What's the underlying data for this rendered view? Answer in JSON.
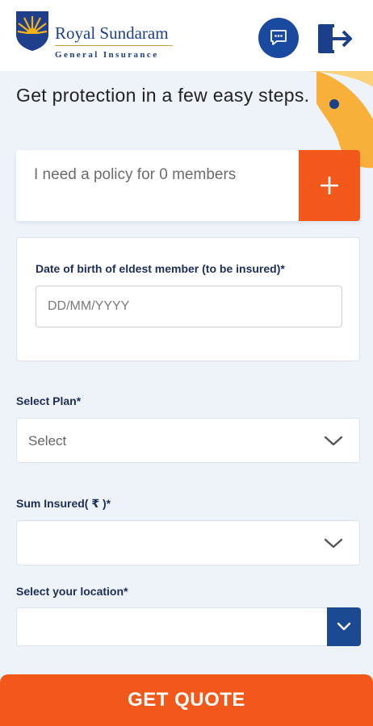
{
  "header": {
    "logo": {
      "name": "Royal Sundaram",
      "tagline": "General Insurance"
    },
    "chat_icon": "chat-bubble-icon",
    "logout_icon": "logout-icon"
  },
  "intro": {
    "heading": "Get protection in a few easy steps."
  },
  "members": {
    "text": "I need a policy for 0 members",
    "add_icon": "plus-icon"
  },
  "dob": {
    "label": "Date of birth of eldest member (to be insured)*",
    "placeholder": "DD/MM/YYYY",
    "value": ""
  },
  "plan": {
    "label": "Select Plan*",
    "value": "Select"
  },
  "sum_insured": {
    "label": "Sum Insured( ₹ )*",
    "value": ""
  },
  "location": {
    "label": "Select your location*",
    "value": ""
  },
  "cta": {
    "label": "GET QUOTE"
  },
  "colors": {
    "brand_blue": "#1a4aa0",
    "accent_orange": "#f2581a",
    "label_navy": "#1d2d57",
    "background": "#eef3fa"
  }
}
